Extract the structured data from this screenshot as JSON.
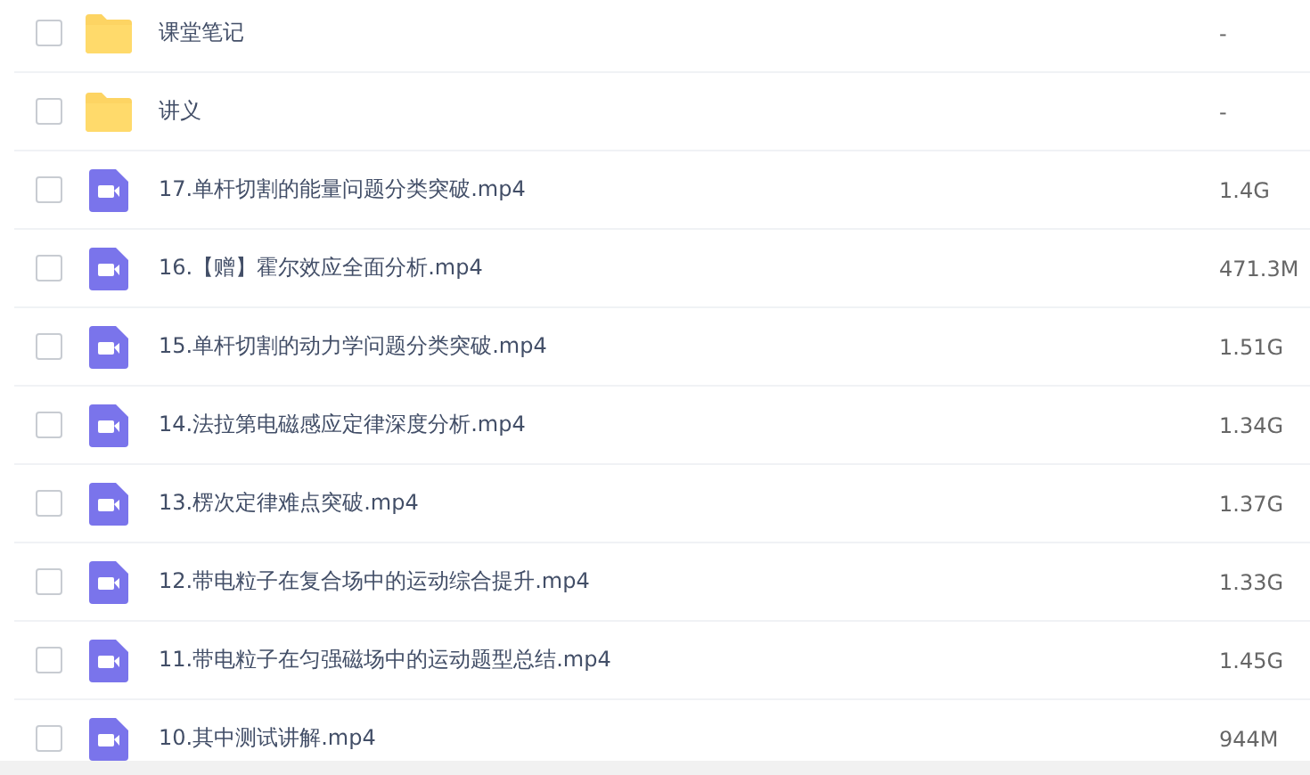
{
  "files": [
    {
      "kind": "folder",
      "name": "课堂笔记",
      "size": "-",
      "checked": false
    },
    {
      "kind": "folder",
      "name": "讲义",
      "size": "-",
      "checked": false
    },
    {
      "kind": "video",
      "name": "17.单杆切割的能量问题分类突破.mp4",
      "size": "1.4G",
      "checked": false
    },
    {
      "kind": "video",
      "name": "16.【赠】霍尔效应全面分析.mp4",
      "size": "471.3M",
      "checked": false
    },
    {
      "kind": "video",
      "name": "15.单杆切割的动力学问题分类突破.mp4",
      "size": "1.51G",
      "checked": false
    },
    {
      "kind": "video",
      "name": "14.法拉第电磁感应定律深度分析.mp4",
      "size": "1.34G",
      "checked": false
    },
    {
      "kind": "video",
      "name": "13.楞次定律难点突破.mp4",
      "size": "1.37G",
      "checked": false
    },
    {
      "kind": "video",
      "name": "12.带电粒子在复合场中的运动综合提升.mp4",
      "size": "1.33G",
      "checked": false
    },
    {
      "kind": "video",
      "name": "11.带电粒子在匀强磁场中的运动题型总结.mp4",
      "size": "1.45G",
      "checked": false
    },
    {
      "kind": "video",
      "name": "10.其中测试讲解.mp4",
      "size": "944M",
      "checked": false
    }
  ]
}
